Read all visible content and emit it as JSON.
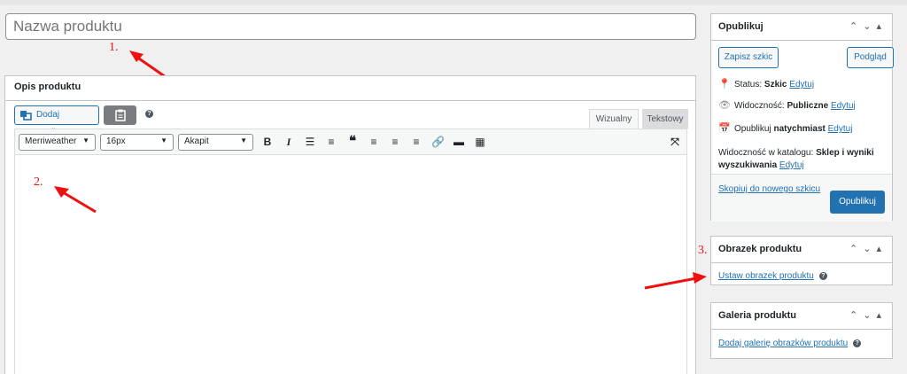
{
  "title_input": {
    "placeholder": "Nazwa produktu"
  },
  "description": {
    "header": "Opis produktu",
    "add_media": "Dodaj medium",
    "tab_visual": "Wizualny",
    "tab_text": "Tekstowy",
    "font_family": "Merriweather",
    "font_size": "16px",
    "paragraph": "Akapit"
  },
  "annotations": {
    "a1": "1.",
    "a2": "2.",
    "a3": "3."
  },
  "publish": {
    "header": "Opublikuj",
    "save_draft": "Zapisz szkic",
    "preview": "Podgląd",
    "status_label": "Status:",
    "status_value": "Szkic",
    "edit": "Edytuj",
    "visibility_label": "Widoczność:",
    "visibility_value": "Publiczne",
    "publish_label": "Opublikuj",
    "publish_value": "natychmiast",
    "catalog_label": "Widoczność w katalogu:",
    "catalog_value_1": "Sklep i wyniki",
    "catalog_value_2": "wyszukiwania",
    "copy_draft": "Skopiuj do nowego szkicu",
    "publish_button": "Opublikuj"
  },
  "product_image": {
    "header": "Obrazek produktu",
    "set_link": "Ustaw obrazek produktu"
  },
  "gallery": {
    "header": "Galeria produktu",
    "add_link": "Dodaj galerię obrazków produktu"
  },
  "colors": {
    "accent": "#2271b1",
    "annotation": "#ee1111"
  }
}
